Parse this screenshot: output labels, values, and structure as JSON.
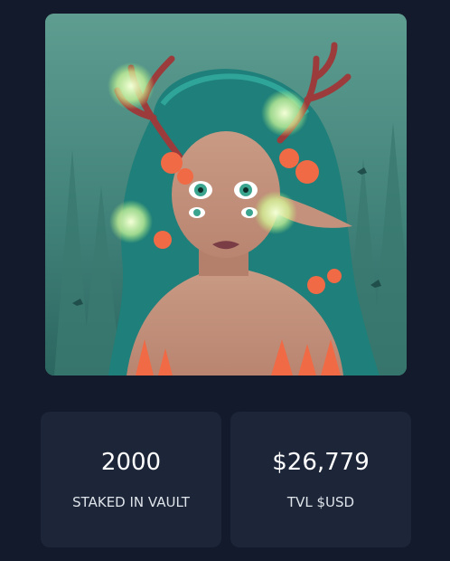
{
  "nft": {
    "image_name": "forest-dryad-nft-art"
  },
  "stats": {
    "staked": {
      "value": "2000",
      "label": "STAKED IN VAULT"
    },
    "tvl": {
      "value": "$26,779",
      "label": "TVL $USD"
    }
  },
  "colors": {
    "background": "#121a2b",
    "card": "#1c2638",
    "text": "#ffffff"
  }
}
